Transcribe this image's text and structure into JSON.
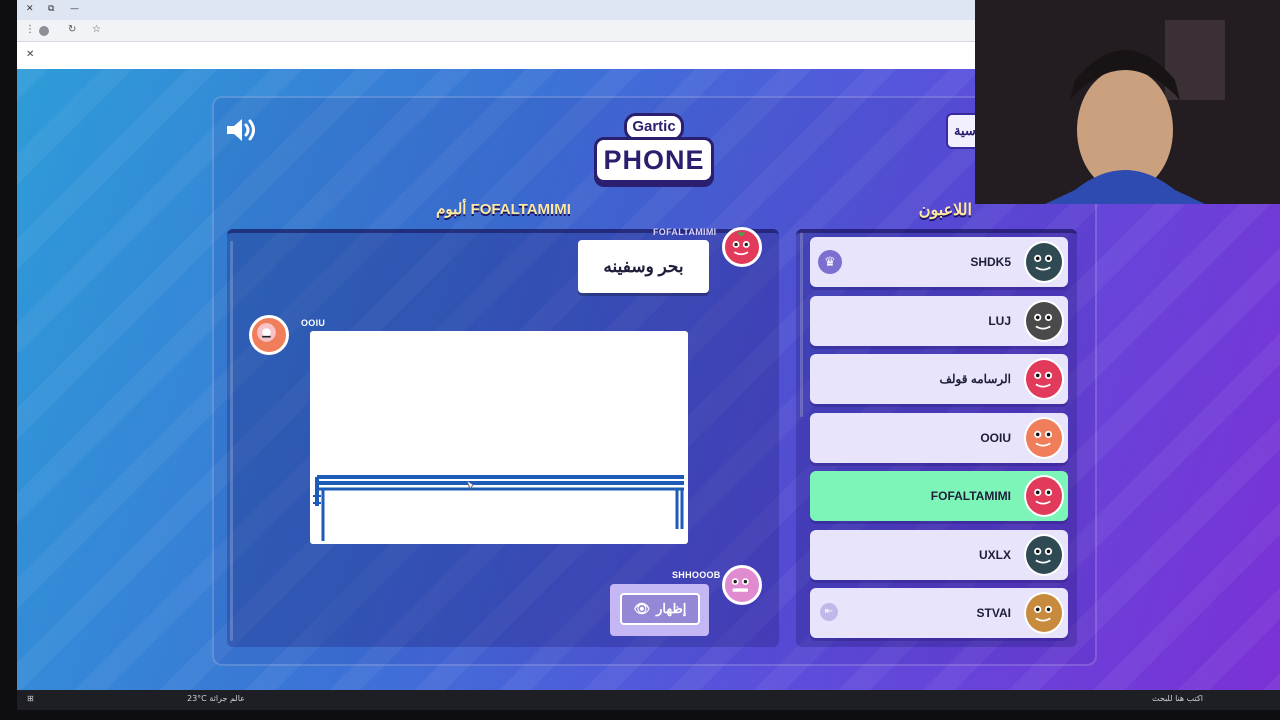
{
  "browser": {
    "window_controls": [
      "✕",
      "⧉",
      "—"
    ],
    "close_tab": "✕"
  },
  "game": {
    "logo_top": "Gartic",
    "logo_bottom": "PHONE",
    "back_label": "سية",
    "album_title": "ألبوم FOFALTAMIMI",
    "players_title": "اللاعبون",
    "reveal_label": "إظهار"
  },
  "album": {
    "entries": [
      {
        "author": "FOFALTAMIMI",
        "type": "text",
        "text": "بحر وسفينه"
      },
      {
        "author": "OOIU",
        "type": "drawing"
      },
      {
        "author": "SHHOOOB",
        "type": "hidden"
      }
    ]
  },
  "players": [
    {
      "name": "SHDK5",
      "badge": "crown",
      "active": false,
      "avatar_color": "#2f4a52"
    },
    {
      "name": "LUJ",
      "badge": "",
      "active": false,
      "avatar_color": "#4a4a4a"
    },
    {
      "name": "الرسامه قولف",
      "badge": "",
      "active": false,
      "avatar_color": "#e23a5a"
    },
    {
      "name": "OOIU",
      "badge": "",
      "active": false,
      "avatar_color": "#f07e5a"
    },
    {
      "name": "FOFALTAMIMI",
      "badge": "",
      "active": true,
      "avatar_color": "#e23a5a"
    },
    {
      "name": "UXLX",
      "badge": "",
      "active": false,
      "avatar_color": "#2f4a52"
    },
    {
      "name": "STVAI",
      "badge": "door",
      "active": false,
      "avatar_color": "#c88a3c"
    }
  ],
  "taskbar": {
    "weather": "23°C عالم جراثة",
    "search_placeholder": "اكتب هنا للبحث"
  },
  "colors": {
    "active_row": "#7ef5b8",
    "row": "#e8e4fb",
    "title": "#ffe7a0",
    "drawing_stroke": "#1e5bb8"
  }
}
